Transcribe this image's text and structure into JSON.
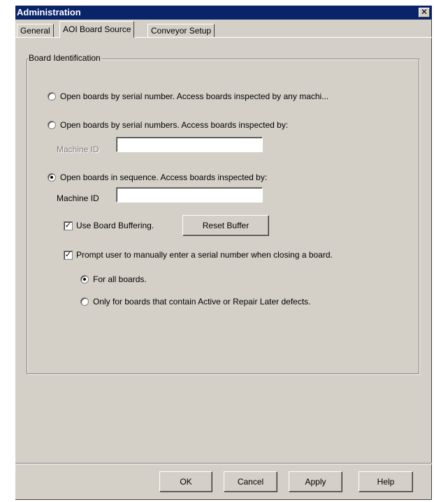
{
  "window": {
    "title": "Administration",
    "close_glyph": "✕"
  },
  "tabs": [
    {
      "label": "General",
      "active": false
    },
    {
      "label": "AOI Board Source",
      "active": true
    },
    {
      "label": "Conveyor Setup",
      "active": false
    }
  ],
  "board_identification": {
    "title": "Board Identification",
    "option1": {
      "label": "Open boards by serial number.  Access boards inspected by any machi...",
      "selected": false
    },
    "option2": {
      "label": "Open boards by serial numbers.  Access boards inspected by:",
      "selected": false,
      "machine_id_label": "Machine ID",
      "machine_id_value": ""
    },
    "option3": {
      "label": "Open boards in sequence.  Access boards inspected by:",
      "selected": true,
      "machine_id_label": "Machine ID",
      "machine_id_value": ""
    },
    "use_buffering": {
      "label": "Use Board Buffering.",
      "checked": true
    },
    "reset_buffer_label": "Reset Buffer",
    "prompt_serial": {
      "label": "Prompt user to manually enter a serial number when closing a board.",
      "checked": true
    },
    "for_all": {
      "label": "For all boards.",
      "selected": true
    },
    "only_defects": {
      "label": "Only for boards that contain Active or Repair Later defects.",
      "selected": false
    }
  },
  "buttons": {
    "ok": "OK",
    "cancel": "Cancel",
    "apply": "Apply",
    "help": "Help"
  },
  "check_glyph": "✓"
}
